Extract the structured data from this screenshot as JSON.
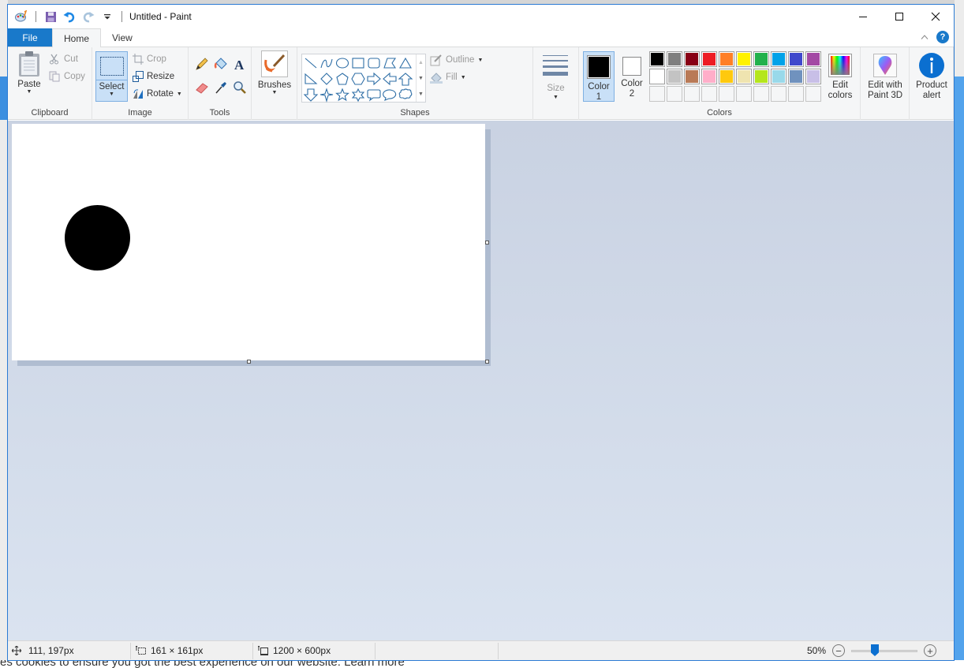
{
  "background": {
    "bottom_text": "es cookies to ensure you got the best experience on our website.  Learn more"
  },
  "titlebar": {
    "title": "Untitled - Paint",
    "qat_icons": [
      "paint-app-icon",
      "save-icon",
      "undo-icon",
      "redo-icon",
      "customize-qat-icon"
    ],
    "minimize_label": "—",
    "maximize_label": "☐",
    "close_label": "✕"
  },
  "tabs": [
    {
      "label": "File",
      "active": false
    },
    {
      "label": "Home",
      "active": true
    },
    {
      "label": "View",
      "active": false
    }
  ],
  "help_label": "?",
  "ribbon": {
    "clipboard": {
      "label": "Clipboard",
      "paste": "Paste",
      "cut": "Cut",
      "copy": "Copy"
    },
    "image": {
      "label": "Image",
      "select": "Select",
      "crop": "Crop",
      "resize": "Resize",
      "rotate": "Rotate"
    },
    "tools": {
      "label": "Tools",
      "items": [
        "pencil",
        "fill",
        "text",
        "eraser",
        "color-picker",
        "magnifier"
      ]
    },
    "brushes": {
      "label": "Brushes"
    },
    "shapes": {
      "label": "Shapes",
      "items": [
        "line",
        "curve",
        "oval",
        "rectangle",
        "rounded-rectangle",
        "polygon",
        "triangle",
        "right-triangle",
        "diamond",
        "pentagon",
        "hexagon",
        "right-arrow",
        "left-arrow",
        "up-arrow",
        "down-arrow",
        "four-point-star",
        "five-point-star",
        "six-point-star",
        "rounded-callout",
        "oval-callout",
        "cloud-callout"
      ],
      "outline": "Outline",
      "fill": "Fill"
    },
    "size": {
      "label": "Size"
    },
    "colors": {
      "label": "Colors",
      "color1": {
        "label_line1": "Color",
        "label_line2": "1",
        "value": "#000000"
      },
      "color2": {
        "label_line1": "Color",
        "label_line2": "2",
        "value": "#ffffff"
      },
      "palette": [
        "#000000",
        "#7f7f7f",
        "#880015",
        "#ed1c24",
        "#ff7f27",
        "#fff200",
        "#22b14c",
        "#00a2e8",
        "#3f48cc",
        "#a349a4",
        "#ffffff",
        "#c3c3c3",
        "#b97a57",
        "#ffaec9",
        "#ffc90e",
        "#efe4b0",
        "#b5e61d",
        "#99d9ea",
        "#7092be",
        "#c8bfe7",
        "",
        "",
        "",
        "",
        "",
        "",
        "",
        "",
        "",
        ""
      ],
      "edit_colors_line1": "Edit",
      "edit_colors_line2": "colors"
    },
    "paint3d": {
      "line1": "Edit with",
      "line2": "Paint 3D"
    },
    "product_alert": {
      "line1": "Product",
      "line2": "alert"
    }
  },
  "canvas": {
    "shape": "filled-circle",
    "shape_color": "#000000"
  },
  "statusbar": {
    "cursor_position": "111, 197px",
    "selection_size": "161 × 161px",
    "image_size": "1200 × 600px",
    "zoom_level": "50%",
    "zoom_fraction": 0.5
  }
}
